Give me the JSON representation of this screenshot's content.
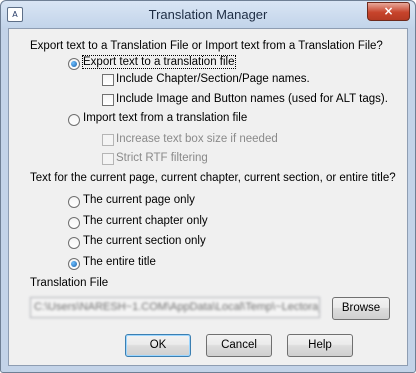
{
  "window": {
    "title": "Translation Manager",
    "app_icon_glyph": "A",
    "close_glyph": "×"
  },
  "mode": {
    "heading": "Export text to a Translation File or Import text from a Translation File?",
    "export_label": "Export text to a translation file",
    "export_selected": true,
    "include_names_label": "Include Chapter/Section/Page names.",
    "include_names_checked": false,
    "include_alt_label": "Include Image and Button names (used for ALT tags).",
    "include_alt_checked": false,
    "import_label": "Import text from a translation file",
    "import_selected": false,
    "increase_label": "Increase text box size if needed",
    "strict_rtf_label": "Strict RTF filtering"
  },
  "scope": {
    "heading": "Text for the current page, current chapter, current section, or entire title?",
    "options": [
      {
        "label": "The current page only",
        "selected": false
      },
      {
        "label": "The current chapter only",
        "selected": false
      },
      {
        "label": "The current section only",
        "selected": false
      },
      {
        "label": "The entire title",
        "selected": true
      }
    ]
  },
  "file": {
    "label": "Translation File",
    "path_value": "C:\\Users\\NARESH~1.COM\\AppData\\Local\\Temp\\~Lectora_",
    "browse_label": "Browse"
  },
  "buttons": {
    "ok": "OK",
    "cancel": "Cancel",
    "help": "Help"
  },
  "colors": {
    "frame": "#c3d3e8",
    "client": "#f0f0f0",
    "close": "#c7442c",
    "radio_dot": "#1a5fa8"
  }
}
